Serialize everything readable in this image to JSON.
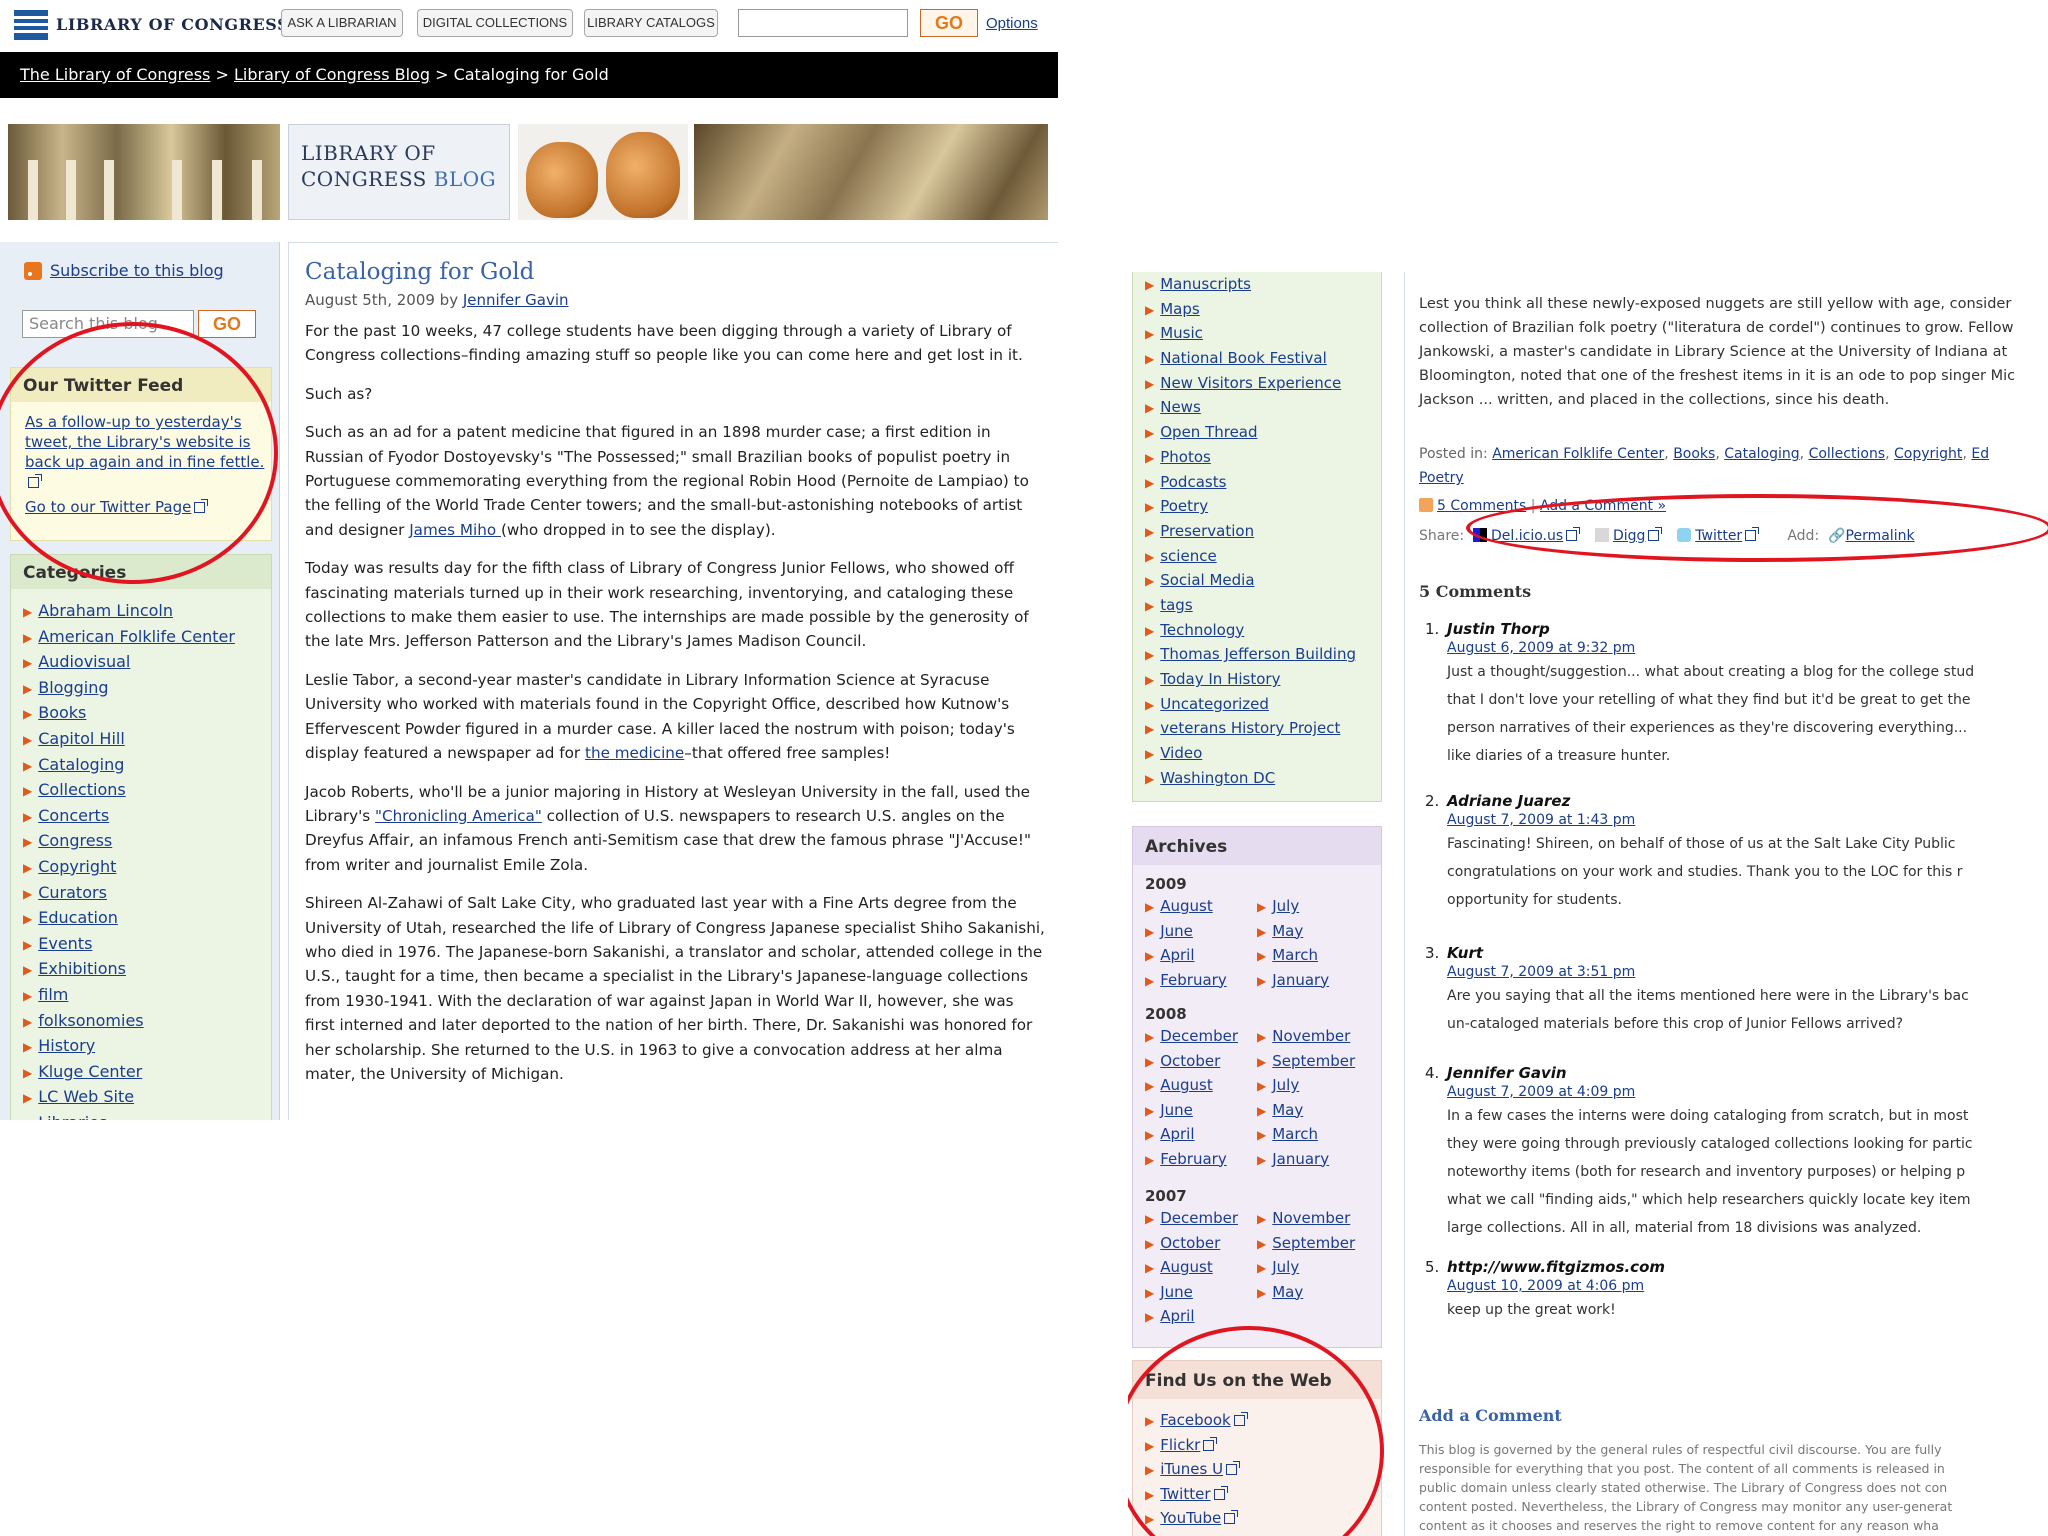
{
  "header": {
    "logo": "LIBRARY OF CONGRESS",
    "buttons": [
      "ASK A LIBRARIAN",
      "DIGITAL COLLECTIONS",
      "LIBRARY CATALOGS"
    ],
    "search_value": "",
    "go": "GO",
    "options": "Options"
  },
  "breadcrumb": {
    "items": [
      "The Library of Congress",
      "Library of Congress Blog",
      "Cataloging for Gold"
    ],
    "sep": ">"
  },
  "banner": {
    "line1": "LIBRARY OF",
    "line2a": "CONGRESS",
    "line2b": "BLOG"
  },
  "sidebar": {
    "subscribe": "Subscribe to this blog",
    "search_placeholder": "Search this blog",
    "go": "GO",
    "twitter": {
      "title": "Our Twitter Feed",
      "tweet": "As a follow-up to yesterday's tweet, the Library's website is back up again and in fine fettle.",
      "page_link": "Go to our Twitter Page"
    },
    "categories": {
      "title": "Categories",
      "items": [
        "Abraham Lincoln",
        "American Folklife Center",
        "Audiovisual",
        "Blogging",
        "Books",
        "Capitol Hill",
        "Cataloging",
        "Collections",
        "Concerts",
        "Congress",
        "Copyright",
        "Curators",
        "Education",
        "Events",
        "Exhibitions",
        "film",
        "folksonomies",
        "History",
        "Kluge Center",
        "LC Web Site",
        "Libraries"
      ]
    }
  },
  "article": {
    "title": "Cataloging for Gold",
    "date_prefix": "August 5th, 2009 by",
    "author": "Jennifer Gavin",
    "p1": "For the past 10 weeks, 47 college students have been digging through a variety of Library of Congress collections–finding amazing stuff so people like you can come here and get lost in it.",
    "p2": "Such as?",
    "p3a": "Such as an ad for a patent medicine that figured in an 1898 murder case; a first edition in Russian of Fyodor Dostoyevsky's \"The Possessed;\" small Brazilian books of populist poetry in Portuguese commemorating everything from the regional Robin Hood (Pernoite de Lampiao) to the felling of the World Trade Center towers; and the small-but-astonishing notebooks of artist and designer ",
    "p3link": "James Miho ",
    "p3b": "(who dropped in to see the display).",
    "p4": "Today was results day for the fifth class of Library of Congress Junior Fellows, who showed off fascinating materials turned up in their work researching, inventorying, and cataloging these collections to make them easier to use. The internships are made possible by the generosity of the late Mrs. Jefferson Patterson and the Library's James Madison Council.",
    "p5a": "Leslie Tabor, a second-year master's candidate in Library Information Science at Syracuse University who worked with materials found in the Copyright Office, described how Kutnow's Effervescent Powder figured in a murder case. A killer laced the nostrum with poison; today's display featured a newspaper ad for ",
    "p5link": "the medicine",
    "p5b": "–that offered free samples!",
    "p6a": "Jacob Roberts, who'll be a junior majoring in History at Wesleyan University in the fall, used the Library's ",
    "p6link": "\"Chronicling America\"",
    "p6b": " collection of U.S. newspapers to research U.S. angles on the Dreyfus Affair, an infamous French anti-Semitism case that drew the famous phrase \"J'Accuse!\" from writer and journalist Emile Zola.",
    "p7": "Shireen Al-Zahawi of Salt Lake City, who graduated last year with a Fine Arts degree from the University of Utah, researched the life of Library of Congress Japanese specialist Shiho Sakanishi, who died in 1976. The Japanese-born Sakanishi, a translator and scholar, attended college in the U.S., taught for a time, then became a specialist in the Library's Japanese-language collections from 1930-1941. With the declaration of war against Japan in World War II, however, she was first interned and later deported to the nation of her birth. There, Dr. Sakanishi was honored for her scholarship. She returned to the U.S. in 1963 to give a convocation address at her alma mater, the University of Michigan."
  },
  "right_sidebar": {
    "categories": [
      "Manuscripts",
      "Maps",
      "Music",
      "National Book Festival",
      "New Visitors Experience",
      "News",
      "Open Thread",
      "Photos",
      "Podcasts",
      "Poetry",
      "Preservation",
      "science",
      "Social Media",
      "tags",
      "Technology",
      "Thomas Jefferson Building",
      "Today In History",
      "Uncategorized",
      "veterans History Project",
      "Video",
      "Washington DC"
    ],
    "archives": {
      "title": "Archives",
      "y2009": "2009",
      "m2009": [
        "August",
        "July",
        "June",
        "May",
        "April",
        "March",
        "February",
        "January"
      ],
      "y2008": "2008",
      "m2008": [
        "December",
        "November",
        "October",
        "September",
        "August",
        "July",
        "June",
        "May",
        "April",
        "March",
        "February",
        "January"
      ],
      "y2007": "2007",
      "m2007": [
        "December",
        "November",
        "October",
        "September",
        "August",
        "July",
        "June",
        "May",
        "April"
      ]
    },
    "findweb": {
      "title": "Find Us on the Web",
      "items": [
        "Facebook",
        "Flickr",
        "iTunes U",
        "Twitter",
        "YouTube"
      ]
    }
  },
  "right_main": {
    "body_lines": [
      "Lest you think all these newly-exposed nuggets are still yellow with age, consider",
      "collection of Brazilian folk poetry (\"literatura de cordel\") continues to grow. Fellow",
      "Jankowski, a master's candidate in Library Science at the University of Indiana at",
      "Bloomington, noted that one of the freshest items in it is an ode to pop singer Mic",
      "Jackson ... written, and placed in the collections, since his death."
    ],
    "posted_prefix": "Posted in:",
    "posted_tags": [
      "American Folklife Center",
      "Books",
      "Cataloging",
      "Collections",
      "Copyright",
      "Ed"
    ],
    "posted_tag2": "Poetry",
    "comments_link": "5 Comments",
    "add_comment_link": "Add a Comment »",
    "share_label": "Share:",
    "share_items": [
      "Del.icio.us",
      "Digg",
      "Twitter"
    ],
    "add_label": "Add:",
    "permalink": "Permalink",
    "comments_heading": "5 Comments",
    "comments": [
      {
        "n": "1.",
        "name": "Justin Thorp",
        "date": "August 6, 2009 at 9:32 pm",
        "lines": [
          "Just a thought/suggestion... what about creating a blog for the college stud",
          "that I don't love your retelling of what they find but it'd be great to get the",
          "person narratives of their experiences as they're discovering everything...",
          "like diaries of a treasure hunter."
        ]
      },
      {
        "n": "2.",
        "name": "Adriane Juarez",
        "date": "August 7, 2009 at 1:43 pm",
        "lines": [
          "Fascinating! Shireen, on behalf of those of us at the Salt Lake City Public",
          "congratulations on your work and studies. Thank you to the LOC for this r",
          "opportunity for students."
        ]
      },
      {
        "n": "3.",
        "name": "Kurt",
        "date": "August 7, 2009 at 3:51 pm",
        "lines": [
          "Are you saying that all the items mentioned here were in the Library's bac",
          "un-cataloged materials before this crop of Junior Fellows arrived?"
        ]
      },
      {
        "n": "4.",
        "name": "Jennifer Gavin",
        "date": "August 7, 2009 at 4:09 pm",
        "lines": [
          "In a few cases the interns were doing cataloging from scratch, but in most",
          "they were going through previously cataloged collections looking for partic",
          "noteworthy items (both for research and inventory purposes) or helping p",
          "what we call \"finding aids,\" which help researchers quickly locate key item",
          "large collections. All in all, material from 18 divisions was analyzed."
        ]
      },
      {
        "n": "5.",
        "name": "http://www.fitgizmos.com",
        "date": "August 10, 2009 at 4:06 pm",
        "lines": [
          "keep up the great work!"
        ]
      }
    ],
    "add_comment_heading": "Add a Comment",
    "rules_lines": [
      "This blog is governed by the general rules of respectful civil discourse. You are fully",
      "responsible for everything that you post. The content of all comments is released in",
      "public domain unless clearly stated otherwise. The Library of Congress does not con",
      "content posted. Nevertheless, the Library of Congress may monitor any user-generat",
      "content as it chooses and reserves the right to remove content for any reason wha"
    ]
  }
}
